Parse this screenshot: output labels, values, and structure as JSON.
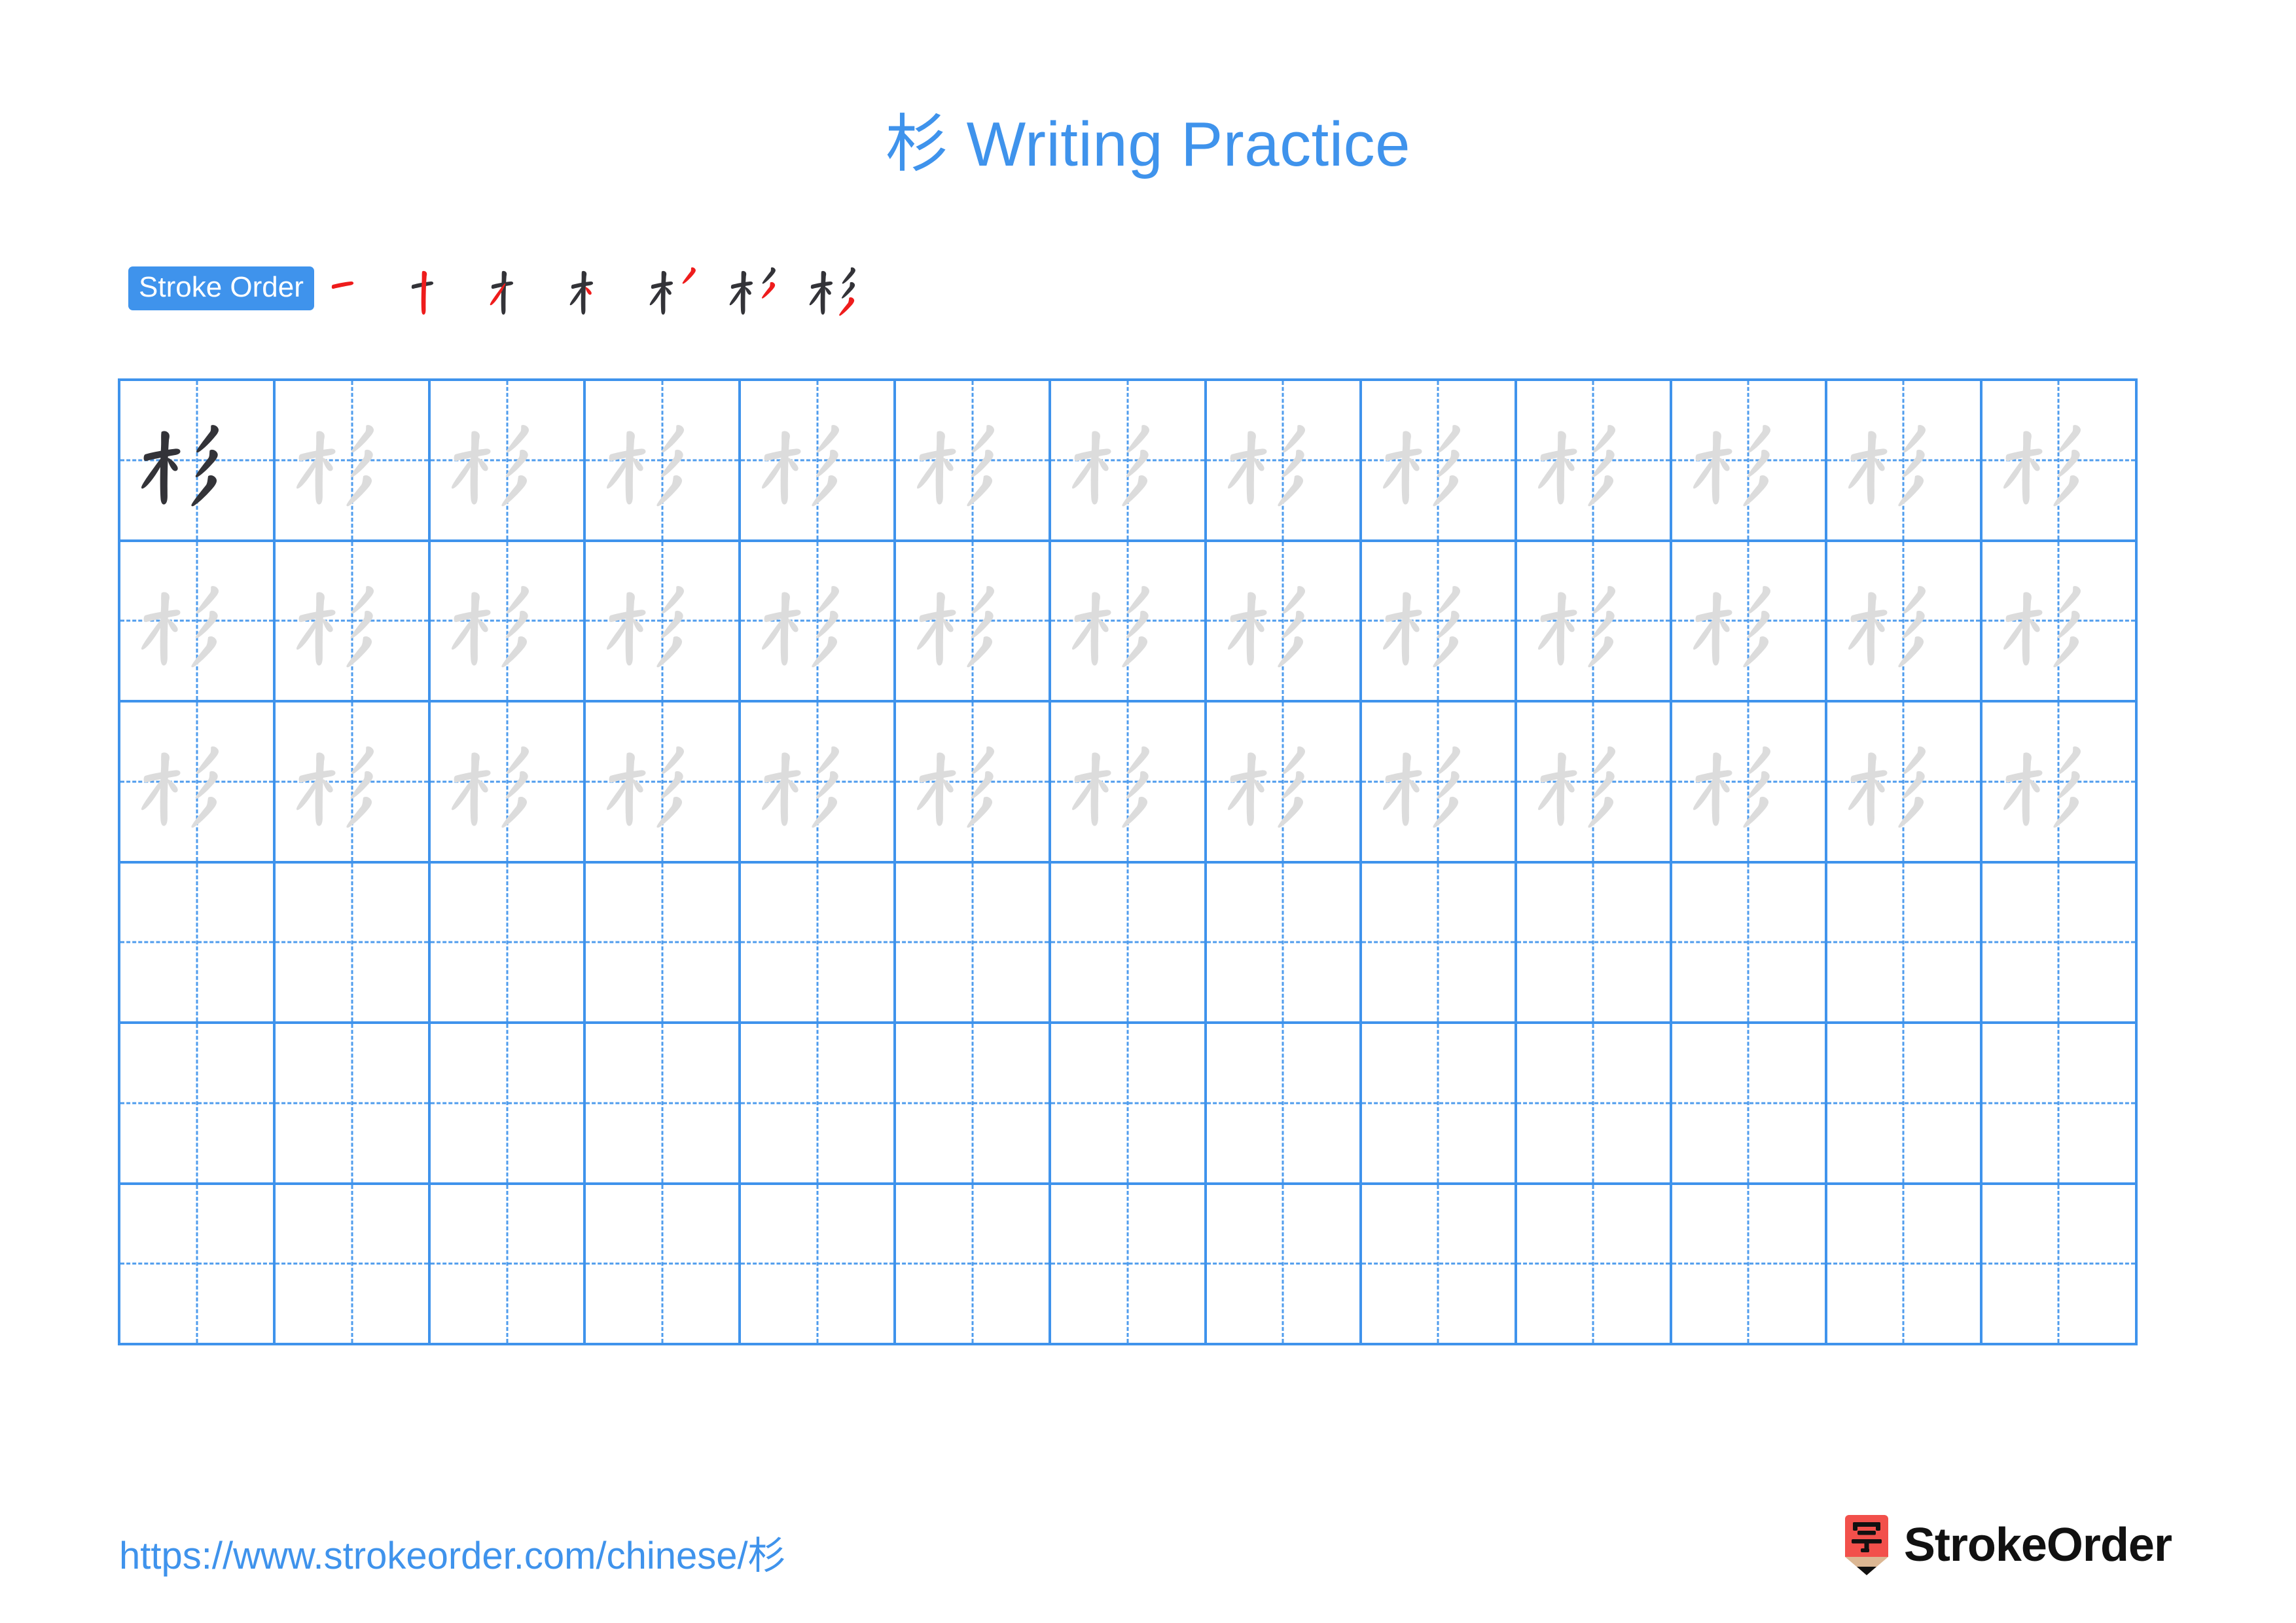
{
  "page": {
    "character": "杉",
    "background_color": "#ffffff"
  },
  "header": {
    "title_character": "杉",
    "title_text": " Writing Practice",
    "title_full": "杉 Writing Practice",
    "title_color": "#3f93ec"
  },
  "stroke_order": {
    "badge_label": "Stroke Order",
    "badge_bg_color": "#3f93ec",
    "badge_text_color": "#ffffff",
    "total_strokes": 7,
    "new_stroke_color": "#ee1c1c",
    "previous_stroke_color": "#333338",
    "steps": [
      {
        "index": 1,
        "strokes_shown": 1,
        "new_stroke": 1,
        "label": "一"
      },
      {
        "index": 2,
        "strokes_shown": 2,
        "new_stroke": 2,
        "label": "十"
      },
      {
        "index": 3,
        "strokes_shown": 3,
        "new_stroke": 3,
        "label": "才"
      },
      {
        "index": 4,
        "strokes_shown": 4,
        "new_stroke": 4,
        "label": "木"
      },
      {
        "index": 5,
        "strokes_shown": 5,
        "new_stroke": 5,
        "label": "杉"
      },
      {
        "index": 6,
        "strokes_shown": 6,
        "new_stroke": 6,
        "label": "杉"
      },
      {
        "index": 7,
        "strokes_shown": 7,
        "new_stroke": 7,
        "label": "杉"
      }
    ]
  },
  "practice_grid": {
    "columns": 13,
    "rows": 6,
    "total_cells": 78,
    "grid_line_color": "#3f93ec",
    "guide_line_color": "#4f9ced",
    "solid_character_color": "#333338",
    "trace_character_color": "#dcdcdc",
    "filled_rows": 3,
    "empty_rows": 3,
    "first_cell_style": "solid",
    "trace_cells_count": 38,
    "cell_character": "杉"
  },
  "footer": {
    "url_base": "https://www.strokeorder.com/chinese/",
    "url_character": "杉",
    "url_full": "https://www.strokeorder.com/chinese/杉",
    "url_color": "#3f93ec",
    "brand_name": "StrokeOrder",
    "brand_mark_character": "字",
    "brand_mark_bg_color": "#f2504b",
    "brand_mark_tip_color": "#dcb793",
    "brand_text_color": "#111111"
  }
}
